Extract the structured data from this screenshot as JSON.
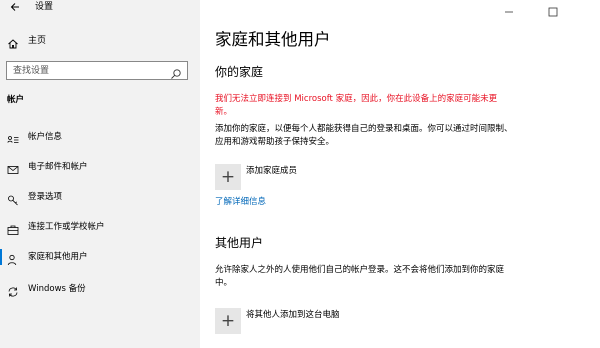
{
  "window": {
    "title": "设置",
    "back_icon": "back-arrow-icon"
  },
  "sidebar": {
    "home_label": "主页",
    "search_placeholder": "查找设置",
    "section_title": "帐户",
    "items": [
      {
        "label": "帐户信息",
        "icon": "account-info-icon"
      },
      {
        "label": "电子邮件和帐户",
        "icon": "mail-icon"
      },
      {
        "label": "登录选项",
        "icon": "key-icon"
      },
      {
        "label": "连接工作或学校帐户",
        "icon": "briefcase-icon"
      },
      {
        "label": "家庭和其他用户",
        "icon": "person-icon"
      },
      {
        "label": "Windows 备份",
        "icon": "sync-icon"
      }
    ]
  },
  "main": {
    "title": "家庭和其他用户",
    "family": {
      "heading": "你的家庭",
      "error": "我们无法立即连接到 Microsoft 家庭，因此，你在此设备上的家庭可能未更新。",
      "description": "添加你的家庭，以便每个人都能获得自己的登录和桌面。你可以通过时间限制、应用和游戏帮助孩子保持安全。",
      "add_label": "添加家庭成员",
      "link": "了解详细信息"
    },
    "others": {
      "heading": "其他用户",
      "description": "允许除家人之外的人使用他们自己的帐户登录。这不会将他们添加到你的家庭中。",
      "add_label": "将其他人添加到这台电脑"
    }
  },
  "colors": {
    "accent": "#0078d7",
    "error": "#e81123",
    "link": "#0067b8",
    "sidebar_bg": "#f2f2f2"
  }
}
